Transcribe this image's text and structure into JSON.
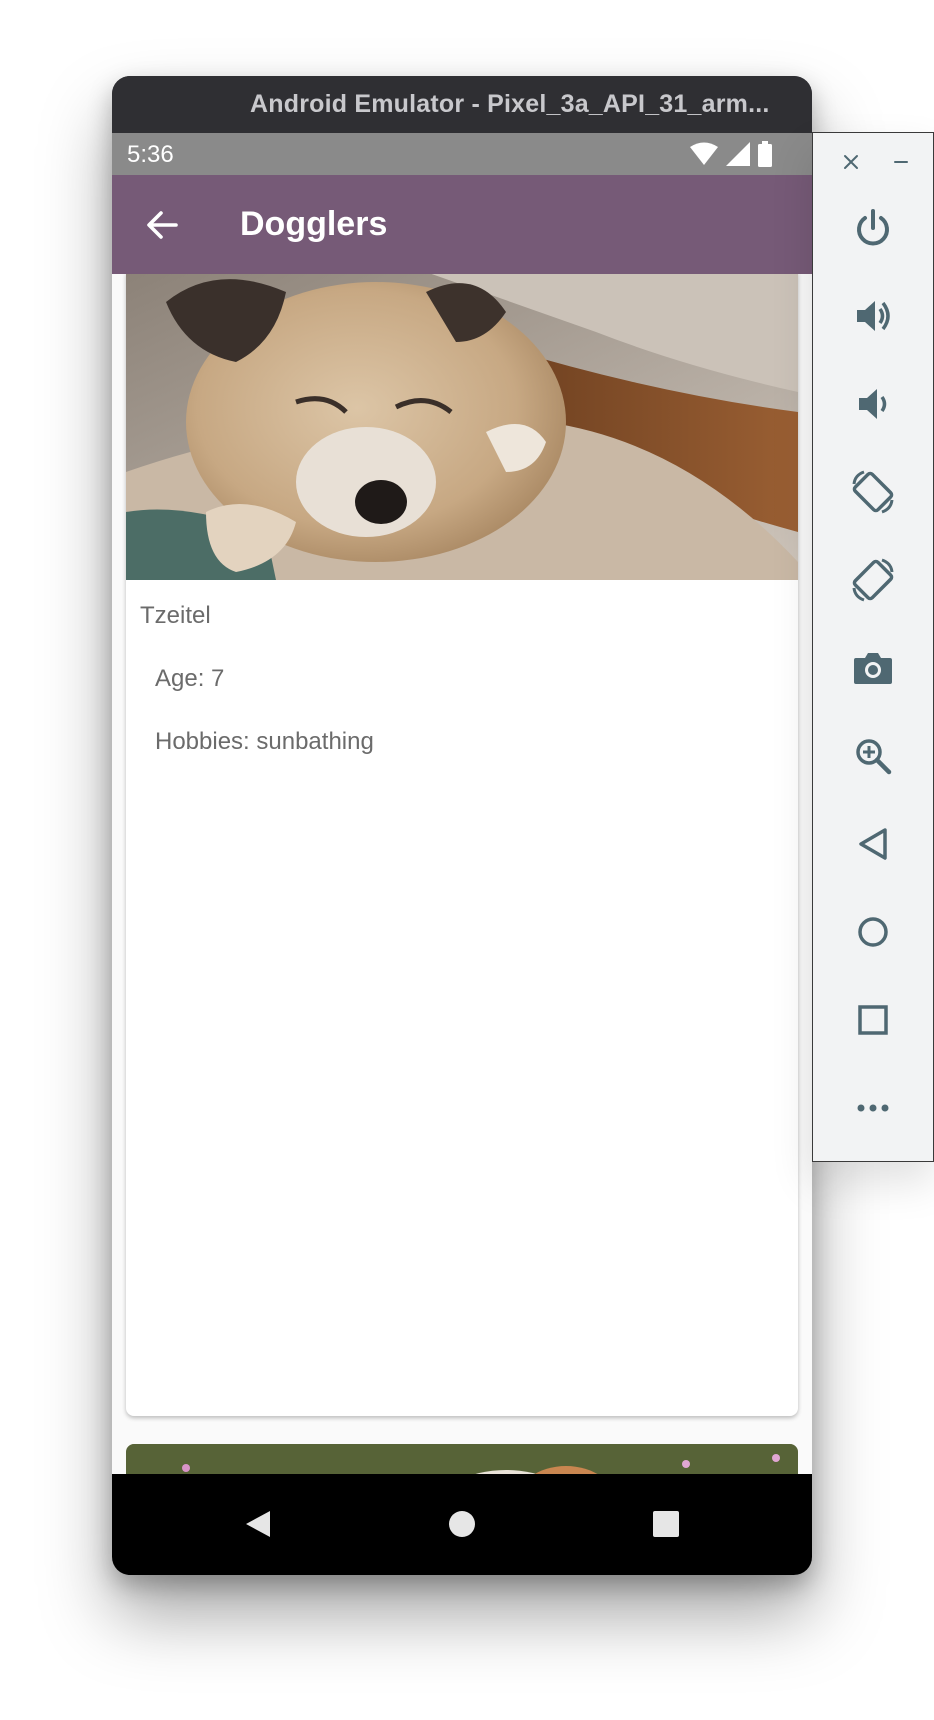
{
  "window": {
    "title": "Android Emulator - Pixel_3a_API_31_arm..."
  },
  "status_bar": {
    "time": "5:36",
    "icons": [
      "wifi-icon",
      "signal-icon",
      "battery-icon"
    ]
  },
  "app_bar": {
    "title": "Dogglers",
    "back_icon": "arrow-back-icon"
  },
  "dog_card": {
    "name": "Tzeitel",
    "age": "Age: 7",
    "hobbies": "Hobbies: sunbathing"
  },
  "nav_bar": {
    "buttons": [
      "back-triangle-icon",
      "home-circle-icon",
      "recents-square-icon"
    ]
  },
  "emulator_toolbar": {
    "top_controls": [
      "close-icon",
      "minimize-icon"
    ],
    "buttons": [
      "power-icon",
      "volume-up-icon",
      "volume-down-icon",
      "rotate-left-icon",
      "rotate-right-icon",
      "camera-icon",
      "zoom-icon",
      "back-icon",
      "home-icon",
      "overview-icon",
      "more-icon"
    ]
  },
  "colors": {
    "app_bar": "#765a77",
    "status_bar": "#8a8a8a",
    "toolbar_icon": "#4f6872",
    "window_frame": "#2f2f33"
  }
}
